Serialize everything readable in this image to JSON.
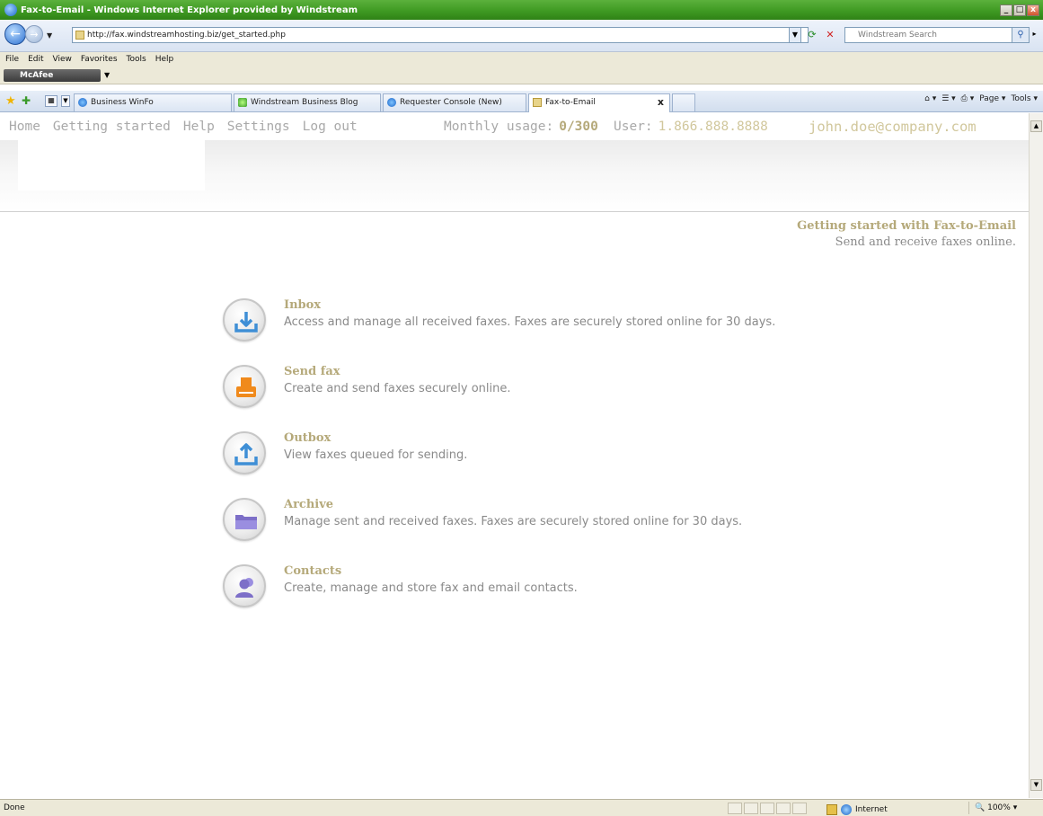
{
  "window": {
    "title": "Fax-to-Email - Windows Internet Explorer provided by Windstream",
    "min": "_",
    "max": "□",
    "close": "x"
  },
  "address": {
    "url": "http://fax.windstreamhosting.biz/get_started.php",
    "search_placeholder": "Windstream Search"
  },
  "menu": [
    "File",
    "Edit",
    "View",
    "Favorites",
    "Tools",
    "Help"
  ],
  "mcafee": {
    "label": "McAfee"
  },
  "tabs": [
    {
      "label": "Business WinFo"
    },
    {
      "label": "Windstream Business Blog"
    },
    {
      "label": "Requester Console (New)"
    },
    {
      "label": "Fax-to-Email"
    }
  ],
  "commandbar": {
    "page": "Page ▾",
    "tools": "Tools ▾"
  },
  "nav": {
    "links": [
      "Home",
      "Getting started",
      "Help",
      "Settings",
      "Log out"
    ],
    "usage_label": "Monthly usage:",
    "usage_value": "0/300",
    "user_label": "User:",
    "user_value": "1.866.888.8888",
    "email": "john.doe@company.com"
  },
  "intro": {
    "title": "Getting started with Fax-to-Email",
    "subtitle": "Send and receive faxes online."
  },
  "features": [
    {
      "title": "Inbox",
      "desc": "Access and manage all received faxes. Faxes are securely stored online for 30 days.",
      "icon": "inbox-icon",
      "color": "#3f8fd6"
    },
    {
      "title": "Send fax",
      "desc": "Create and send faxes securely online.",
      "icon": "send-fax-icon",
      "color": "#f08a1c"
    },
    {
      "title": "Outbox",
      "desc": "View faxes queued for sending.",
      "icon": "outbox-icon",
      "color": "#3f8fd6"
    },
    {
      "title": "Archive",
      "desc": "Manage sent and received faxes. Faxes are securely stored online for 30 days.",
      "icon": "archive-icon",
      "color": "#7d6fc8"
    },
    {
      "title": "Contacts",
      "desc": "Create, manage and store fax and email contacts.",
      "icon": "contacts-icon",
      "color": "#7d6fc8"
    }
  ],
  "status": {
    "left": "Done",
    "zone": "Internet",
    "zoom": "100%"
  }
}
